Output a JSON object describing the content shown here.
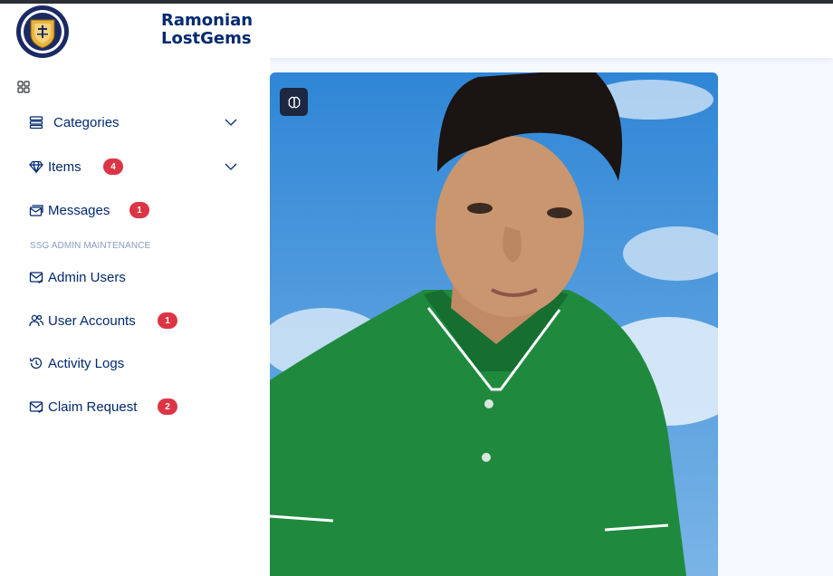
{
  "header": {
    "brand_line1": "Ramonian",
    "brand_line2": "LostGems",
    "logo_icon": "school-seal-logo"
  },
  "sidebar": {
    "toggle_icon": "grid-icon",
    "items": [
      {
        "label": "Categories",
        "icon": "layout-list-icon",
        "expandable": true
      },
      {
        "label": "Items",
        "icon": "gem-icon",
        "badge": "4",
        "expandable": true
      },
      {
        "label": "Messages",
        "icon": "envelope-stack-icon",
        "badge": "1"
      }
    ],
    "section_heading": "SSG ADMIN MAINTENANCE",
    "admin_items": [
      {
        "label": "Admin Users",
        "icon": "envelope-check-icon"
      },
      {
        "label": "User Accounts",
        "icon": "people-icon",
        "badge": "2_hidden",
        "badge_text": "1"
      },
      {
        "label": "Activity Logs",
        "icon": "history-icon"
      },
      {
        "label": "Claim Request",
        "icon": "envelope-check-icon",
        "badge_text": "2"
      }
    ]
  },
  "main": {
    "photo_icon": "profile-photo",
    "overlay_button_icon": "brain-icon"
  },
  "colors": {
    "brand": "#012970",
    "badge": "#dc3545",
    "topline": "#2b2f36",
    "page_bg": "#f6f9ff"
  }
}
